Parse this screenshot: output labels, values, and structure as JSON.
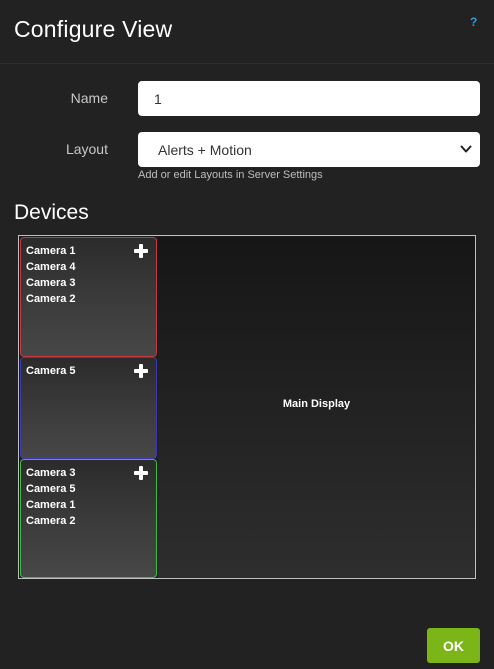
{
  "dialog": {
    "title": "Configure View",
    "help_label": "?"
  },
  "form": {
    "name_label": "Name",
    "name_value": "1",
    "layout_label": "Layout",
    "layout_value": "Alerts + Motion",
    "layout_help": "Add or edit Layouts in Server Settings"
  },
  "devices": {
    "heading": "Devices",
    "slots": [
      {
        "border_color": "#c0393b",
        "cameras": [
          "Camera 1",
          "Camera 4",
          "Camera 3",
          "Camera 2"
        ]
      },
      {
        "border_color": "#3b3bb8",
        "cameras": [
          "Camera 5"
        ]
      },
      {
        "border_color": "#3fbf3f",
        "cameras": [
          "Camera 3",
          "Camera 5",
          "Camera 1",
          "Camera 2"
        ]
      }
    ],
    "main_display_label": "Main Display",
    "add_icon": "plus-icon"
  },
  "footer": {
    "ok_label": "OK"
  },
  "colors": {
    "background": "#222222",
    "accent_ok": "#7cb518",
    "help": "#2e9bdc"
  }
}
